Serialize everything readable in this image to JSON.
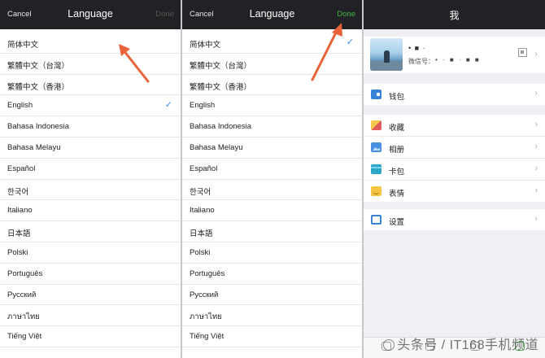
{
  "panel1": {
    "cancel": "Cancel",
    "title": "Language",
    "done": "Done",
    "languages": [
      "简体中文",
      "繁體中文（台灣）",
      "繁體中文（香港）",
      "English",
      "Bahasa Indonesia",
      "Bahasa Melayu",
      "Español",
      "한국어",
      "Italiano",
      "日本語",
      "Polski",
      "Português",
      "Русский",
      "ภาษาไทย",
      "Tiếng Việt"
    ],
    "checked_index": 3,
    "check_icon": "checkmark-icon",
    "accent": "#3b8ef0"
  },
  "panel2": {
    "cancel": "Cancel",
    "title": "Language",
    "done": "Done",
    "languages": [
      "简体中文",
      "繁體中文（台灣）",
      "繁體中文（香港）",
      "English",
      "Bahasa Indonesia",
      "Bahasa Melayu",
      "Español",
      "한국어",
      "Italiano",
      "日本語",
      "Polski",
      "Português",
      "Русский",
      "ภาษาไทย",
      "Tiếng Việt"
    ],
    "checked_index": 0,
    "done_color": "#44b549"
  },
  "panel3": {
    "title": "我",
    "profile": {
      "nickname": "• ■ ·",
      "wechat_id_label": "微信号：",
      "wechat_id": "• ·  ■ · ■ ■",
      "qr_icon": "qr-code-icon"
    },
    "wallet": {
      "label": "钱包",
      "icon": "wallet-icon"
    },
    "group2": [
      {
        "label": "收藏",
        "icon": "favorites-icon"
      },
      {
        "label": "相册",
        "icon": "album-icon"
      },
      {
        "label": "卡包",
        "icon": "card-icon"
      },
      {
        "label": "表情",
        "icon": "emoji-icon"
      }
    ],
    "settings": {
      "label": "设置",
      "icon": "settings-icon"
    }
  },
  "annotation": {
    "arrow_color": "#e8633a"
  },
  "watermark": {
    "text": "头条号 / IT168手机频道"
  }
}
